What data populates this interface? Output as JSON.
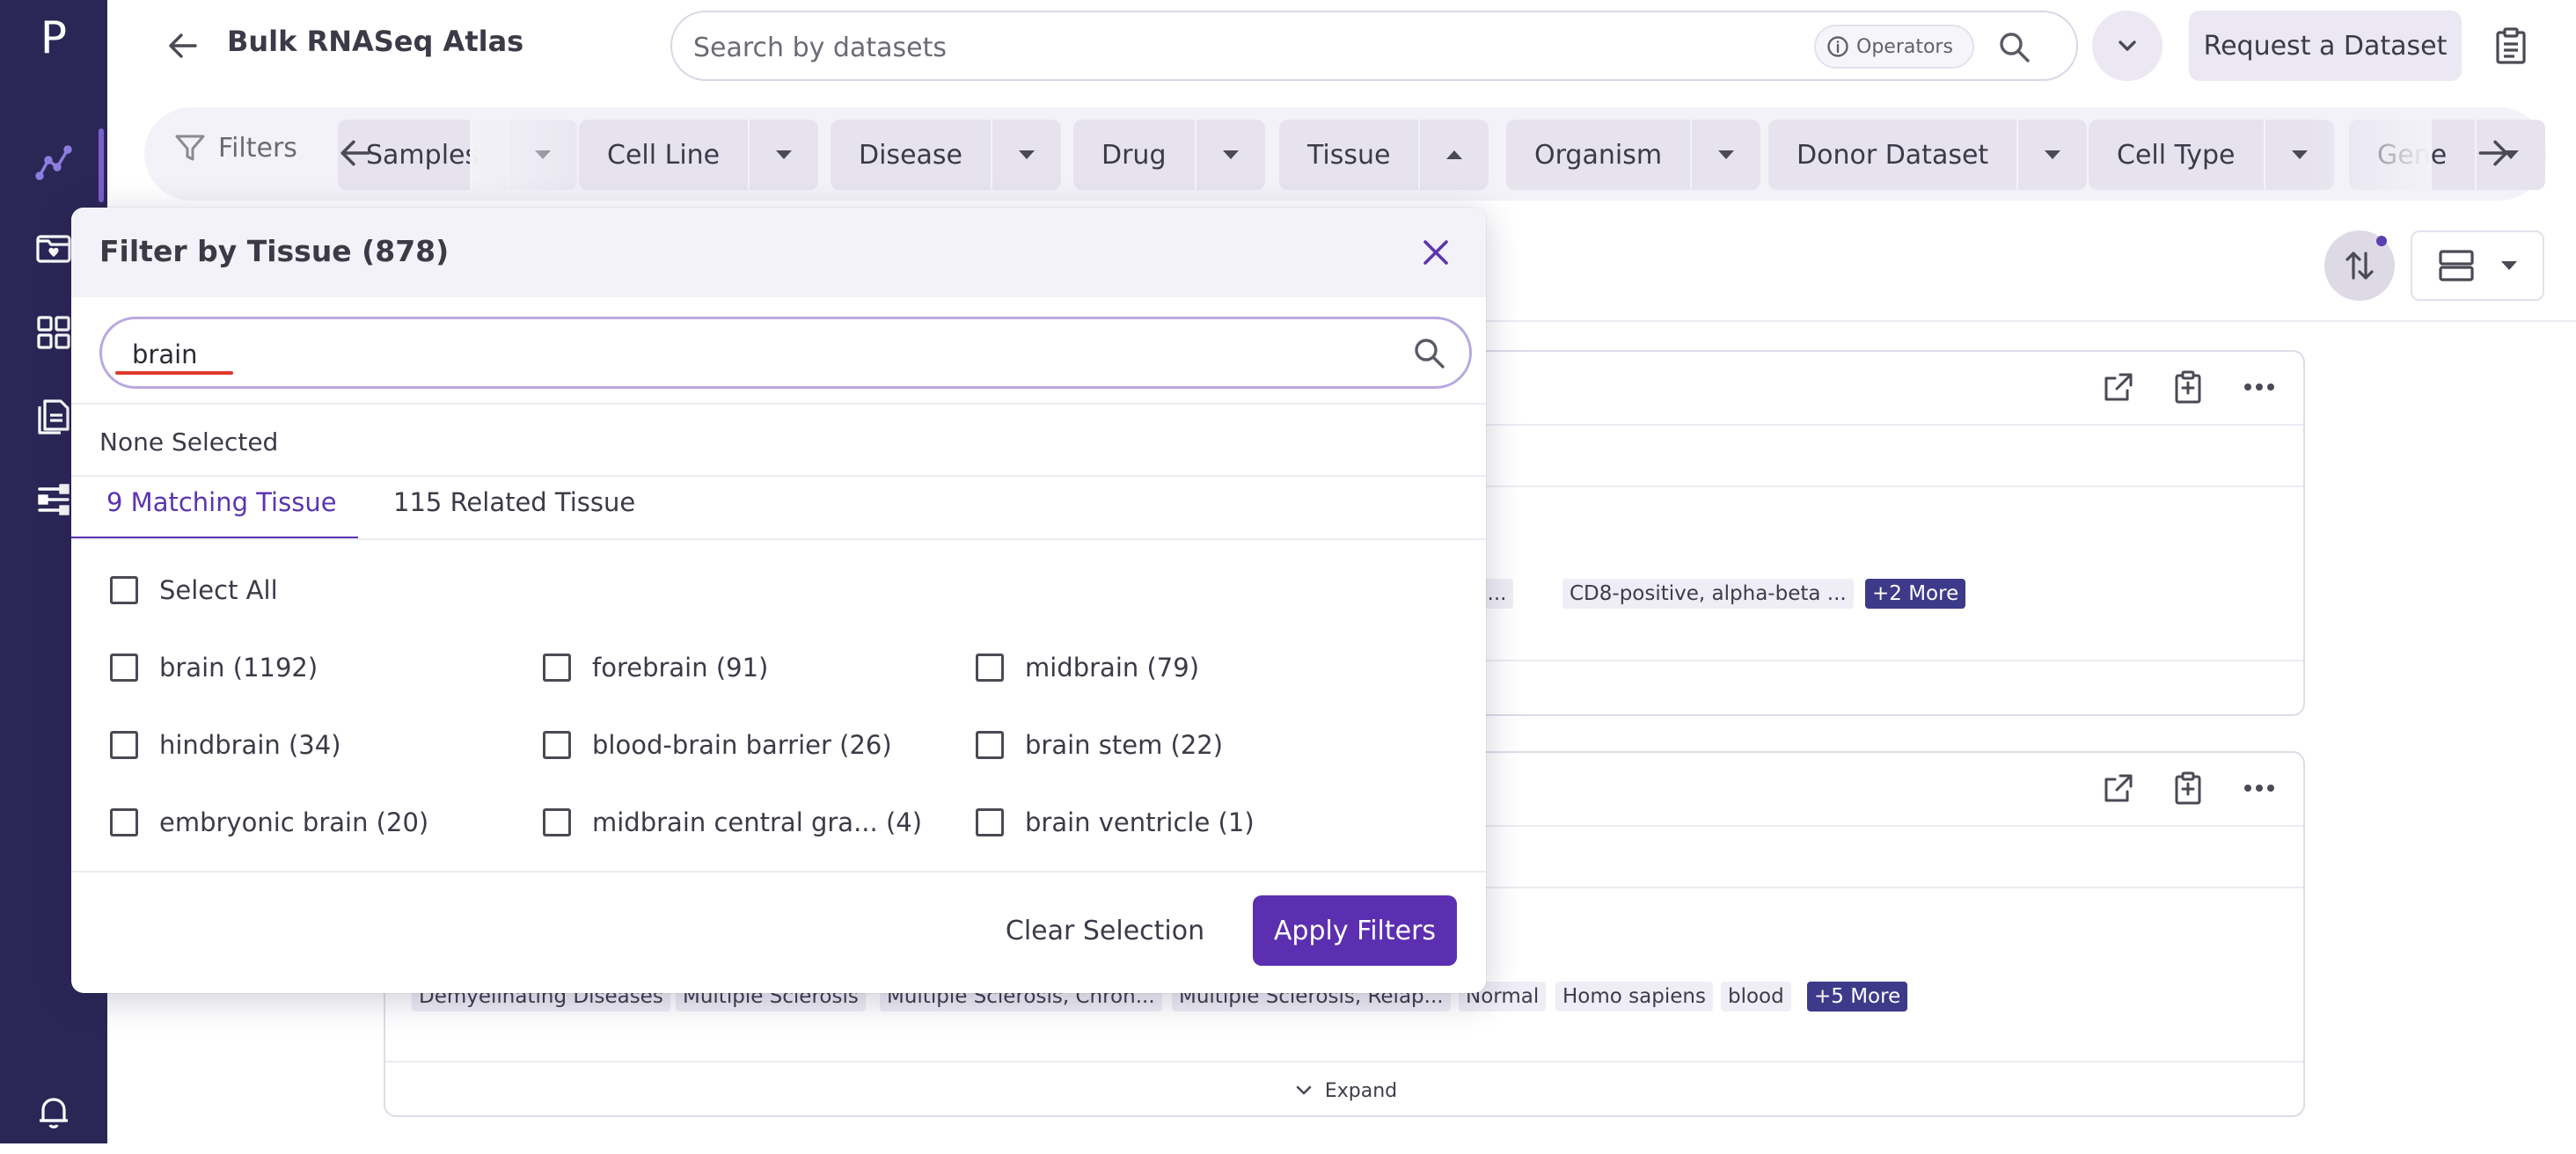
{
  "app": {
    "logo_letter": "P",
    "title": "Bulk RNASeq Atlas"
  },
  "rail": {
    "items": [
      "explore-icon",
      "inbox-heart-icon",
      "grid-icon",
      "documents-icon",
      "pipeline-icon"
    ],
    "bottom": "bell-icon"
  },
  "header": {
    "search_placeholder": "Search by datasets",
    "operators_label": "Operators",
    "request_label": "Request a Dataset"
  },
  "filterbar": {
    "label": "Filters",
    "chips": [
      {
        "label": "Samples"
      },
      {
        "label": "Cell Line"
      },
      {
        "label": "Disease"
      },
      {
        "label": "Drug"
      },
      {
        "label": "Tissue",
        "open": true
      },
      {
        "label": "Organism"
      },
      {
        "label": "Donor Dataset"
      },
      {
        "label": "Cell Type"
      },
      {
        "label": "Gene"
      }
    ]
  },
  "cards": {
    "card1": {
      "tags": [
        "T cel...",
        "CD8-positive, alpha-beta ...",
        "+2 More"
      ]
    },
    "card2": {
      "tags": [
        "Demyelinating Diseases",
        "Multiple Sclerosis",
        "Multiple Sclerosis, Chron...",
        "Multiple Sclerosis, Relap...",
        "Normal",
        "Homo sapiens",
        "blood",
        "+5 More"
      ],
      "expand_label": "Expand"
    }
  },
  "modal": {
    "title": "Filter by Tissue (878)",
    "search_value": "brain",
    "selection_status": "None Selected",
    "tabs": [
      {
        "label": "9 Matching Tissue",
        "active": true
      },
      {
        "label": "115 Related Tissue",
        "active": false
      }
    ],
    "select_all_label": "Select All",
    "options": [
      "brain (1192)",
      "forebrain (91)",
      "midbrain (79)",
      "hindbrain (34)",
      "blood-brain barrier (26)",
      "brain stem (22)",
      "embryonic brain (20)",
      "midbrain central gra... (4)",
      "brain ventricle (1)"
    ],
    "clear_label": "Clear Selection",
    "apply_label": "Apply Filters"
  },
  "colors": {
    "rail_bg": "#2a2655",
    "accent": "#5b2fb0",
    "chip_bg": "#e6e3ef",
    "more_tag": "#3d3a8a"
  }
}
